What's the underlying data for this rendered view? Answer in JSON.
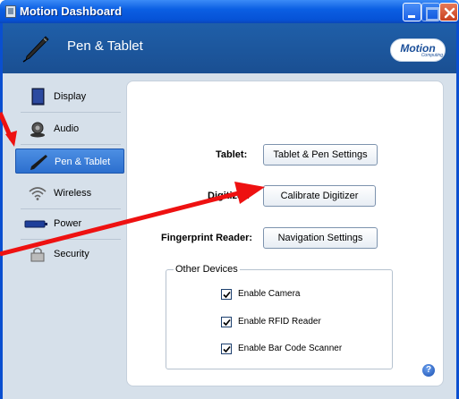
{
  "window": {
    "title": "Motion Dashboard"
  },
  "header": {
    "title": "Pen & Tablet",
    "icon": "pen-icon",
    "brand": {
      "name": "Motion",
      "sub": "Computing"
    }
  },
  "sidebar": {
    "items": [
      {
        "label": "Display",
        "icon": "display-icon"
      },
      {
        "label": "Audio",
        "icon": "speaker-icon"
      },
      {
        "label": "Pen & Tablet",
        "icon": "pen-icon",
        "active": true
      },
      {
        "label": "Wireless",
        "icon": "wireless-icon"
      },
      {
        "label": "Power",
        "icon": "battery-icon"
      },
      {
        "label": "Security",
        "icon": "lock-icon"
      }
    ]
  },
  "main": {
    "tablet_label": "Tablet:",
    "tablet_button": "Tablet & Pen Settings",
    "digitizer_label": "Digitizer:",
    "digitizer_button": "Calibrate Digitizer",
    "fingerprint_label": "Fingerprint Reader:",
    "fingerprint_button": "Navigation Settings",
    "other_devices": {
      "title": "Other Devices",
      "options": [
        {
          "label": "Enable Camera",
          "checked": true
        },
        {
          "label": "Enable RFID Reader",
          "checked": true
        },
        {
          "label": "Enable Bar Code Scanner",
          "checked": true
        }
      ]
    },
    "help": "?"
  },
  "colors": {
    "titlebar": "#0b5fe3",
    "header": "#1f5fa9",
    "sidebar_bg": "#d6e0ea",
    "active_item": "#2c6fce",
    "annotation_arrow": "#ee1111"
  }
}
